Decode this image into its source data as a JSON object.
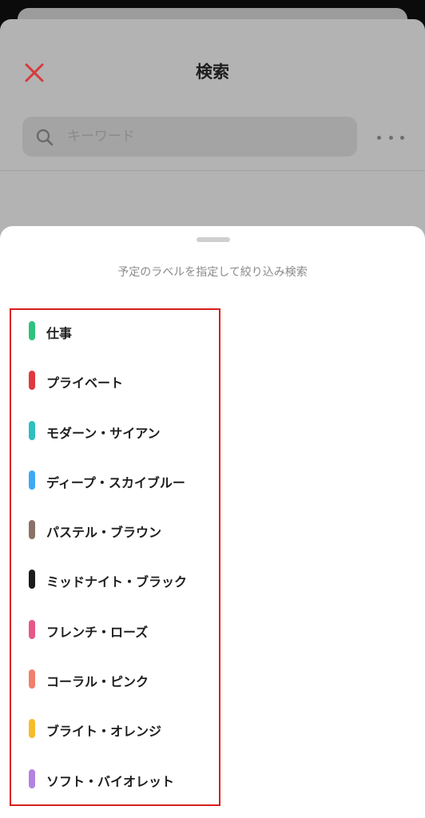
{
  "header": {
    "title": "検索",
    "close_icon": "close-icon",
    "close_color": "#d63a3a"
  },
  "search": {
    "placeholder": "キーワード",
    "value": "",
    "icon": "search-icon",
    "more_icon": "more-dots-icon"
  },
  "sheet": {
    "title": "予定のラベルを指定して絞り込み検索",
    "highlight_color": "#d81e1e",
    "labels": [
      {
        "name": "仕事",
        "color": "#2ec27e"
      },
      {
        "name": "プライベート",
        "color": "#e0393e"
      },
      {
        "name": "モダーン・サイアン",
        "color": "#2ebfbf"
      },
      {
        "name": "ディープ・スカイブルー",
        "color": "#3fa9f5"
      },
      {
        "name": "パステル・ブラウン",
        "color": "#8b7268"
      },
      {
        "name": "ミッドナイト・ブラック",
        "color": "#1c1c1c"
      },
      {
        "name": "フレンチ・ローズ",
        "color": "#e6588a"
      },
      {
        "name": "コーラル・ピンク",
        "color": "#f0806c"
      },
      {
        "name": "ブライト・オレンジ",
        "color": "#f5bd2a"
      },
      {
        "name": "ソフト・バイオレット",
        "color": "#b283e0"
      }
    ]
  }
}
